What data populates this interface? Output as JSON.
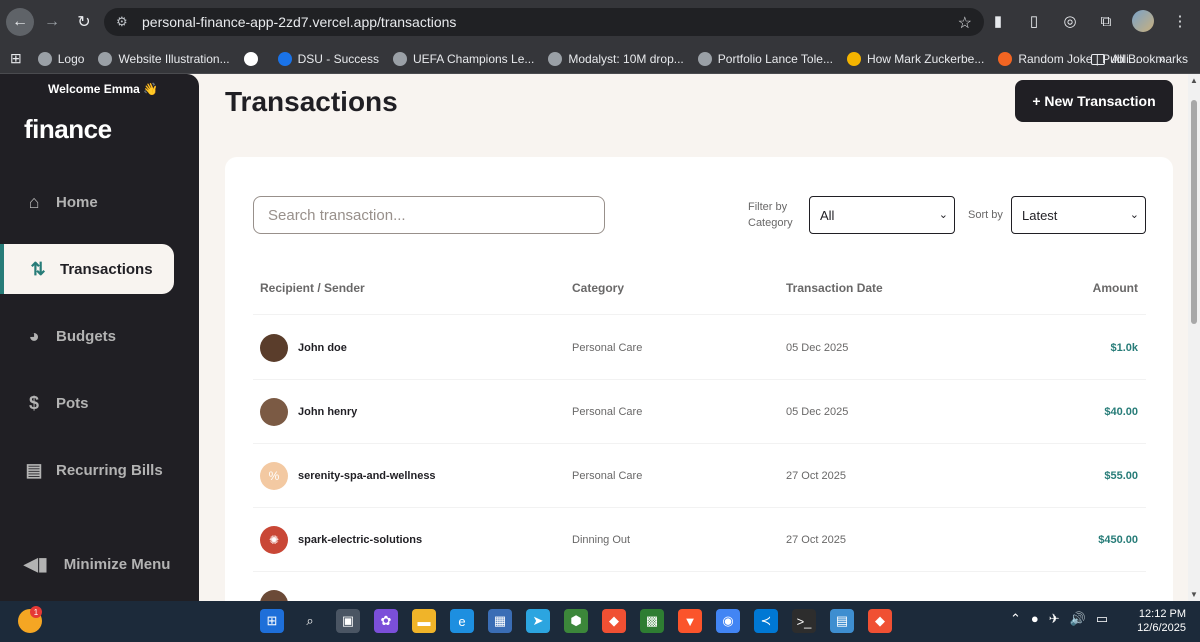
{
  "browser": {
    "url": "personal-finance-app-2zd7.vercel.app/transactions",
    "bookmarks": [
      {
        "label": "Logo"
      },
      {
        "label": "Website Illustration..."
      },
      {
        "label": ""
      },
      {
        "label": "DSU - Success"
      },
      {
        "label": "UEFA Champions Le..."
      },
      {
        "label": "Modalyst: 10M drop..."
      },
      {
        "label": "Portfolio Lance Tole..."
      },
      {
        "label": "How Mark Zuckerbe..."
      },
      {
        "label": "Random Joke | Publi..."
      }
    ],
    "all_bookmarks": "All Bookmarks",
    "more": "»"
  },
  "sidebar": {
    "welcome": "Welcome Emma 👋",
    "logo": "finance",
    "items": [
      {
        "label": "Home",
        "icon": "home-icon",
        "active": false
      },
      {
        "label": "Transactions",
        "icon": "transactions-icon",
        "active": true
      },
      {
        "label": "Budgets",
        "icon": "budgets-icon",
        "active": false
      },
      {
        "label": "Pots",
        "icon": "pots-icon",
        "active": false
      },
      {
        "label": "Recurring Bills",
        "icon": "recurring-bills-icon",
        "active": false
      }
    ],
    "minimize": "Minimize Menu"
  },
  "main": {
    "title": "Transactions",
    "new_button": "+ New Transaction",
    "search_placeholder": "Search transaction...",
    "filter_label_1": "Filter by",
    "filter_label_2": "Category",
    "filter_value": "All",
    "sort_label": "Sort by",
    "sort_value": "Latest",
    "columns": {
      "recipient": "Recipient / Sender",
      "category": "Category",
      "date": "Transaction Date",
      "amount": "Amount"
    },
    "rows": [
      {
        "name": "John doe",
        "category": "Personal Care",
        "date": "05 Dec 2025",
        "amount": "$1.0k",
        "avatar_color": "#5a3d2b"
      },
      {
        "name": "John henry",
        "category": "Personal Care",
        "date": "05 Dec 2025",
        "amount": "$40.00",
        "avatar_color": "#7b5a44"
      },
      {
        "name": "serenity-spa-and-wellness",
        "category": "Personal Care",
        "date": "27 Oct 2025",
        "amount": "$55.00",
        "avatar_color": "#f3c9a2"
      },
      {
        "name": "spark-electric-solutions",
        "category": "Dinning Out",
        "date": "27 Oct 2025",
        "amount": "$450.00",
        "avatar_color": "#c94736"
      }
    ]
  },
  "taskbar": {
    "badge": "1",
    "time": "12:12 PM",
    "date": "12/6/2025"
  },
  "colors": {
    "accent": "#277c78",
    "dark": "#201f24",
    "beige": "#f8f4f0"
  }
}
